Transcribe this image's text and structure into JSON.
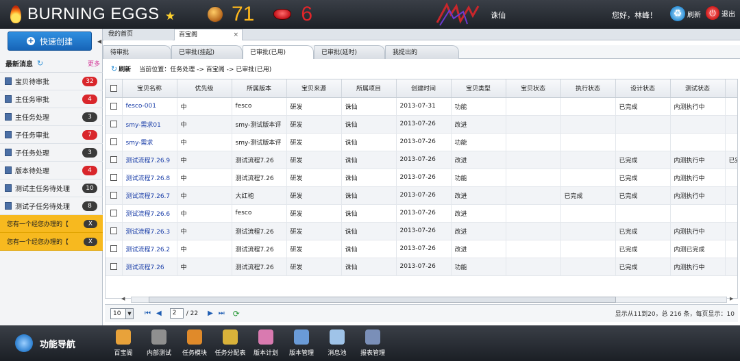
{
  "header": {
    "brand": "BURNING EGGS",
    "eggs_count": "71",
    "lips_count": "6",
    "game_name": "诛仙",
    "greeting": "您好，林峰！",
    "refresh_label": "刷新",
    "logout_label": "退出"
  },
  "sidebar": {
    "quick_create": "快速创建",
    "news_title": "最新消息",
    "more": "更多",
    "items": [
      {
        "label": "宝贝待审批",
        "count": "32",
        "color": "red"
      },
      {
        "label": "主任务审批",
        "count": "4",
        "color": "red"
      },
      {
        "label": "主任务处理",
        "count": "3",
        "color": "gray"
      },
      {
        "label": "子任务审批",
        "count": "7",
        "color": "red"
      },
      {
        "label": "子任务处理",
        "count": "3",
        "color": "gray"
      },
      {
        "label": "版本待处理",
        "count": "4",
        "color": "red"
      },
      {
        "label": "测试主任务待处理",
        "count": "10",
        "color": "gray"
      },
      {
        "label": "测试子任务待处理",
        "count": "8",
        "color": "gray"
      }
    ],
    "notices": [
      {
        "text": "您有一个经您办理的【",
        "close": "X"
      },
      {
        "text": "您有一个经您办理的【",
        "close": "X"
      }
    ]
  },
  "tabs": {
    "home": "我的首页",
    "active": "百宝阁",
    "close": "×"
  },
  "subtabs": [
    "待审批",
    "已审批(挂起)",
    "已审批(已用)",
    "已审批(延时)",
    "我提出的"
  ],
  "breadcrumb": {
    "refresh": "刷新",
    "location": "当前位置：任务处理 -> 百宝阁 -> 已审批(已用)"
  },
  "table": {
    "columns": [
      "宝贝名称",
      "优先级",
      "所属版本",
      "宝贝来源",
      "所属项目",
      "创建时间",
      "宝贝类型",
      "宝贝状态",
      "执行状态",
      "设计状态",
      "测试状态",
      ""
    ],
    "rows": [
      [
        "fesco-001",
        "中",
        "fesco",
        "研发",
        "诛仙",
        "2013-07-31",
        "功能",
        "",
        "",
        "已完成",
        "内测执行中",
        ""
      ],
      [
        "smy-需求01",
        "中",
        "smy-测试版本评",
        "研发",
        "诛仙",
        "2013-07-26",
        "改进",
        "",
        "",
        "",
        "",
        ""
      ],
      [
        "smy-需求",
        "中",
        "smy-测试版本评",
        "研发",
        "诛仙",
        "2013-07-26",
        "功能",
        "",
        "",
        "",
        "",
        ""
      ],
      [
        "测试流程7.26.9",
        "中",
        "测试流程7.26",
        "研发",
        "诛仙",
        "2013-07-26",
        "改进",
        "",
        "",
        "已完成",
        "内测执行中",
        "已完"
      ],
      [
        "测试流程7.26.8",
        "中",
        "测试流程7.26",
        "研发",
        "诛仙",
        "2013-07-26",
        "功能",
        "",
        "",
        "已完成",
        "内测执行中",
        ""
      ],
      [
        "测试流程7.26.7",
        "中",
        "大红袍",
        "研发",
        "诛仙",
        "2013-07-26",
        "改进",
        "",
        "已完成",
        "已完成",
        "内测执行中",
        ""
      ],
      [
        "测试流程7.26.6",
        "中",
        "fesco",
        "研发",
        "诛仙",
        "2013-07-26",
        "改进",
        "",
        "",
        "",
        "",
        ""
      ],
      [
        "测试流程7.26.3",
        "中",
        "测试流程7.26",
        "研发",
        "诛仙",
        "2013-07-26",
        "改进",
        "",
        "",
        "已完成",
        "内测执行中",
        ""
      ],
      [
        "测试流程7.26.2",
        "中",
        "测试流程7.26",
        "研发",
        "诛仙",
        "2013-07-26",
        "改进",
        "",
        "",
        "已完成",
        "内测已完成",
        ""
      ],
      [
        "测试流程7.26",
        "中",
        "测试流程7.26",
        "研发",
        "诛仙",
        "2013-07-26",
        "功能",
        "",
        "",
        "已完成",
        "内测执行中",
        ""
      ]
    ]
  },
  "pager": {
    "page_size": "10",
    "current_page": "2",
    "total_pages": "/ 22",
    "info": "显示从11到20，总 216 条，每页显示：10"
  },
  "bottom": {
    "feature_nav": "功能导航",
    "items": [
      {
        "label": "百宝阁",
        "color": "#e8a23a"
      },
      {
        "label": "内部测试",
        "color": "#8f8f8f"
      },
      {
        "label": "任务模块",
        "color": "#e08a2a"
      },
      {
        "label": "任务分配表",
        "color": "#d9b23a"
      },
      {
        "label": "版本计划",
        "color": "#d97ab0"
      },
      {
        "label": "版本管理",
        "color": "#6a9bd8"
      },
      {
        "label": "消息池",
        "color": "#9fc3e8"
      },
      {
        "label": "报表管理",
        "color": "#7a8fb8"
      }
    ]
  }
}
